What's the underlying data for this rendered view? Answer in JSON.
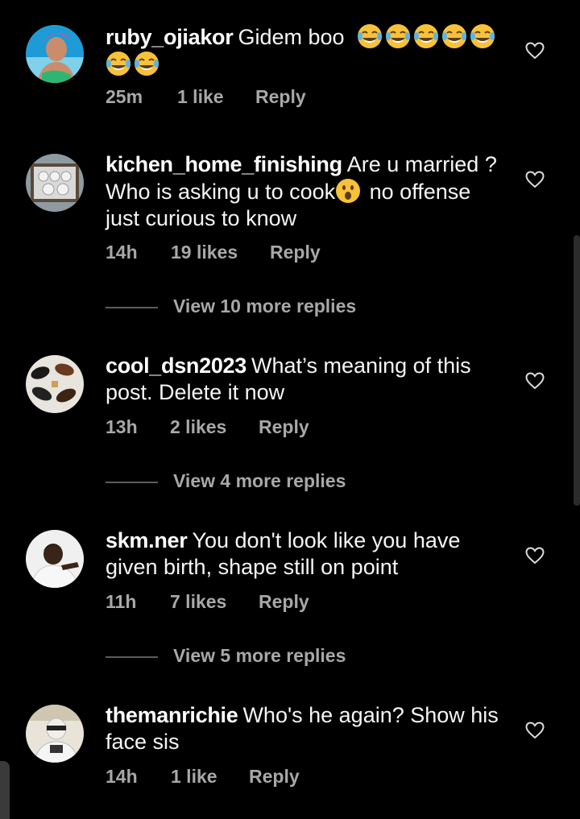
{
  "comments": [
    {
      "username": "ruby_ojiakor",
      "text": "Gidem boo",
      "emoji": "face-with-tears-of-joy",
      "emoji_count": 7,
      "time": "25m",
      "likes": "1 like",
      "reply_label": "Reply"
    },
    {
      "username": "kichen_home_finishing",
      "text_before": "Are u married ? Who is asking u to cook",
      "emoji": "face-with-open-mouth",
      "text_after": " no offense just curious to know",
      "time": "14h",
      "likes": "19 likes",
      "reply_label": "Reply",
      "view_replies": "View 10 more replies"
    },
    {
      "username": "cool_dsn2023",
      "text": "What’s meaning of this post.  Delete it now",
      "time": "13h",
      "likes": "2 likes",
      "reply_label": "Reply",
      "view_replies": "View 4 more replies"
    },
    {
      "username": "skm.ner",
      "text": "You don't look like you have given birth, shape still on point",
      "time": "11h",
      "likes": "7 likes",
      "reply_label": "Reply",
      "view_replies": "View 5 more replies"
    },
    {
      "username": "themanrichie",
      "text": "Who's he again? Show his face sis",
      "time": "14h",
      "likes": "1 like",
      "reply_label": "Reply"
    }
  ],
  "colors": {
    "background": "#000000",
    "text": "#f5f5f5",
    "meta": "#a8a8a8"
  },
  "icons": {
    "like": "heart-outline-icon"
  }
}
